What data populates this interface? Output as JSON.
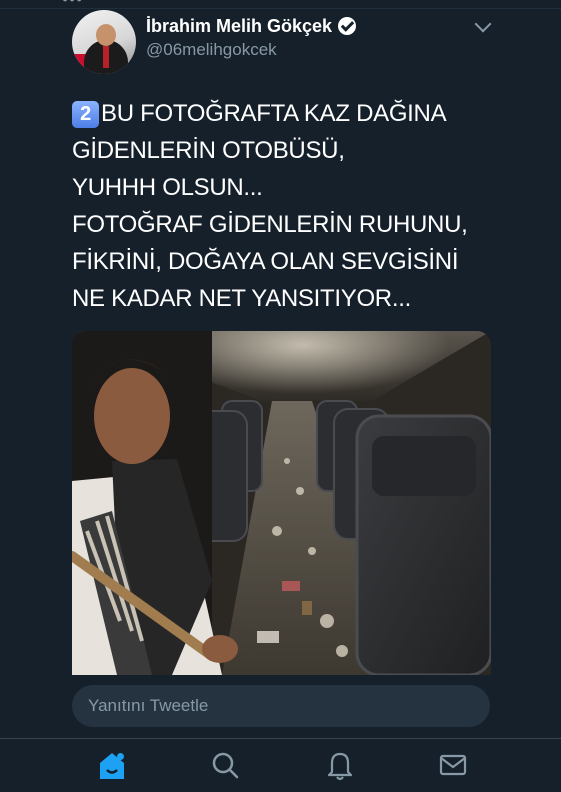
{
  "tweet": {
    "author": {
      "display_name": "İbrahim Melih Gökçek",
      "handle": "@06melihgokcek",
      "verified": true
    },
    "keycap": "2",
    "text_lines": [
      "BU FOTOĞRAFTA KAZ DAĞINA",
      "GİDENLERİN OTOBÜSÜ,",
      "YUHHH OLSUN...",
      "FOTOĞRAF GİDENLERİN RUHUNU,",
      "FİKRİNİ, DOĞAYA OLAN SEVGİSİNİ",
      "NE KADAR NET YANSITIYOR..."
    ]
  },
  "reply": {
    "placeholder": "Yanıtını Tweetle"
  },
  "tabbar": {
    "tabs": [
      "home-icon",
      "search-icon",
      "notifications-icon",
      "messages-icon"
    ],
    "active": "home-icon"
  },
  "colors": {
    "background": "#15202b",
    "accent": "#1da1f2",
    "secondary_text": "#8899a6",
    "reply_box": "#253341"
  }
}
